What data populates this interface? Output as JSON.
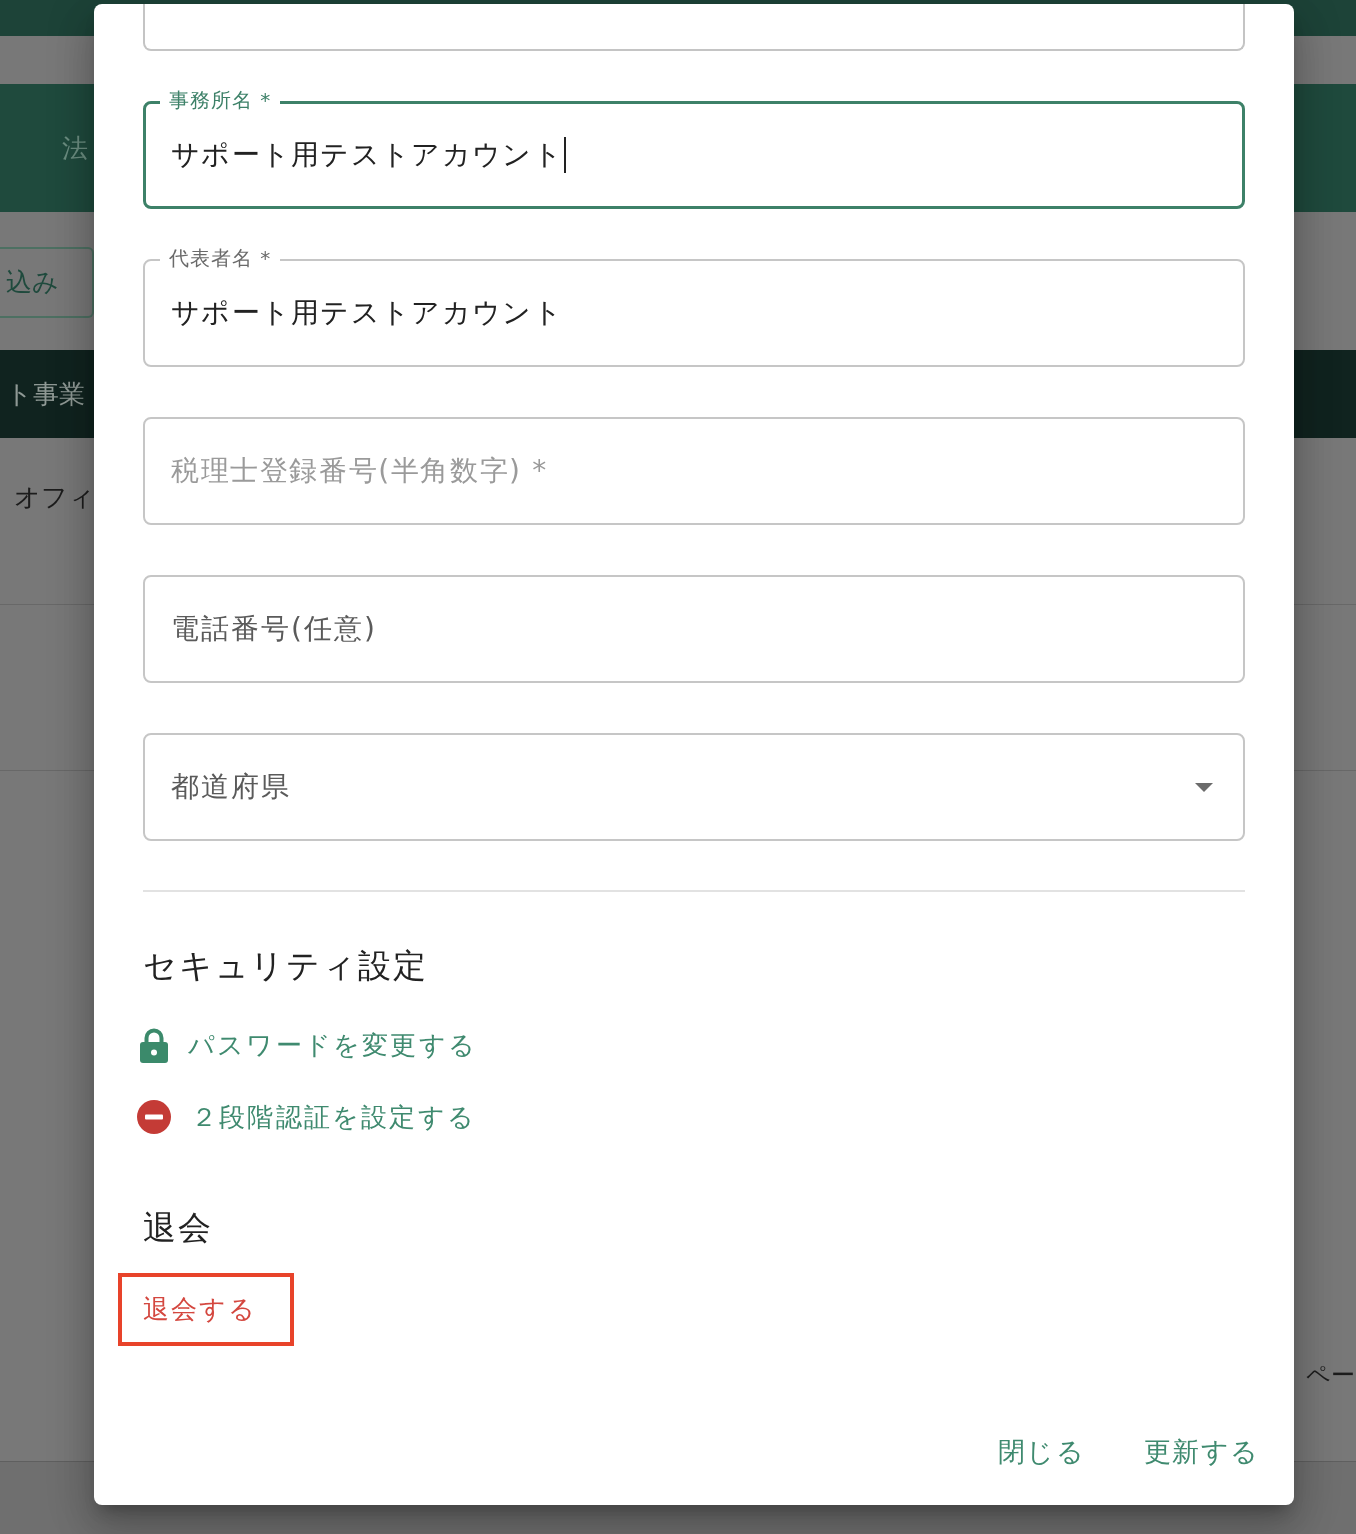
{
  "background": {
    "header_title": "法",
    "filter_button": "込み",
    "table": {
      "columns": [
        "ト事業"
      ],
      "rows": [
        {
          "column_1": "オフィ"
        }
      ]
    },
    "pagination_label": "ペー"
  },
  "dialog": {
    "fields": [
      {
        "kind": "partial"
      },
      {
        "kind": "text",
        "label": "事務所名 *",
        "value": "サポート用テストアカウント",
        "focused": true
      },
      {
        "kind": "text",
        "label": "代表者名 *",
        "value": "サポート用テストアカウント",
        "focused": false
      },
      {
        "kind": "text",
        "placeholder": "税理士登録番号(半角数字) *",
        "focused": false
      },
      {
        "kind": "text",
        "label": "電話番号(任意)",
        "focused": false
      },
      {
        "kind": "select",
        "label": "都道府県",
        "focused": false
      }
    ],
    "security": {
      "heading": "セキュリティ設定",
      "links": [
        {
          "kind": "lock",
          "label": "パスワードを変更する"
        },
        {
          "kind": "blocked",
          "label": "２段階認証を設定する"
        }
      ]
    },
    "withdrawal": {
      "heading": "退会",
      "link": {
        "label": "退会する",
        "highlighted": true
      }
    },
    "buttons": [
      {
        "label": "閉じる"
      },
      {
        "label": "更新する"
      }
    ]
  }
}
